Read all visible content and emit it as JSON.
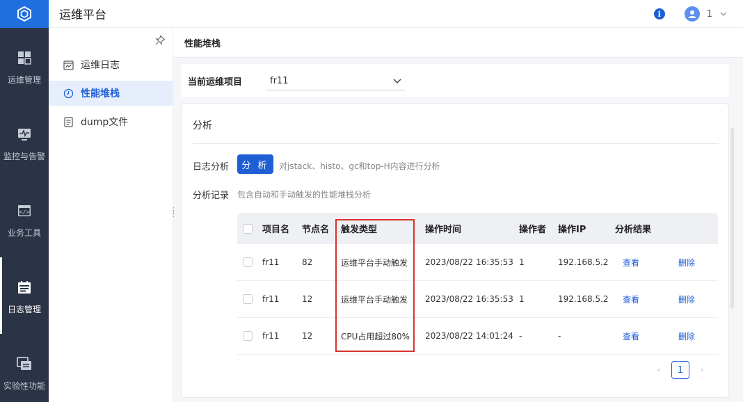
{
  "app": {
    "title": "运维平台",
    "user_name": "1",
    "info_glyph": "i"
  },
  "rail": [
    {
      "label": "运维管理",
      "icon": "dashboard-icon",
      "active": false
    },
    {
      "label": "监控与告警",
      "icon": "monitor-icon",
      "active": false
    },
    {
      "label": "业务工具",
      "icon": "code-window-icon",
      "active": false
    },
    {
      "label": "日志管理",
      "icon": "calendar-log-icon",
      "active": true
    },
    {
      "label": "实验性功能",
      "icon": "experiment-window-icon",
      "active": false
    }
  ],
  "subnav": [
    {
      "label": "运维日志",
      "icon": "chart-log-icon",
      "active": false
    },
    {
      "label": "性能堆栈",
      "icon": "clock-icon",
      "active": true
    },
    {
      "label": "dump文件",
      "icon": "file-icon",
      "active": false
    }
  ],
  "page": {
    "header": "性能堆栈"
  },
  "project": {
    "label": "当前运维项目",
    "value": "fr11"
  },
  "analysis": {
    "title": "分析",
    "log_label": "日志分析",
    "button": "分 析",
    "log_hint": "对jstack、histo、gc和top-H内容进行分析",
    "record_label": "分析记录",
    "record_hint": "包含自动和手动触发的性能堆栈分析"
  },
  "table": {
    "columns": [
      "项目名",
      "节点名",
      "触发类型",
      "操作时间",
      "操作者",
      "操作IP",
      "分析结果"
    ],
    "rows": [
      {
        "project": "fr11",
        "node": "82",
        "trigger": "运维平台手动触发",
        "time": "2023/08/22 16:35:53",
        "operator": "1",
        "ip": "192.168.5.2",
        "view": "查看",
        "delete": "删除"
      },
      {
        "project": "fr11",
        "node": "12",
        "trigger": "运维平台手动触发",
        "time": "2023/08/22 16:35:53",
        "operator": "1",
        "ip": "192.168.5.2",
        "view": "查看",
        "delete": "删除"
      },
      {
        "project": "fr11",
        "node": "12",
        "trigger": "CPU占用超过80%",
        "time": "2023/08/22 14:01:24",
        "operator": "-",
        "ip": "-",
        "view": "查看",
        "delete": "删除"
      }
    ]
  },
  "pagination": {
    "current": "1",
    "prev": "‹",
    "next": "›"
  },
  "colors": {
    "primary": "#1f5fd6",
    "rail_bg": "#2b3446",
    "logo_bg": "#1f6fe0",
    "highlight": "#d9322b"
  }
}
